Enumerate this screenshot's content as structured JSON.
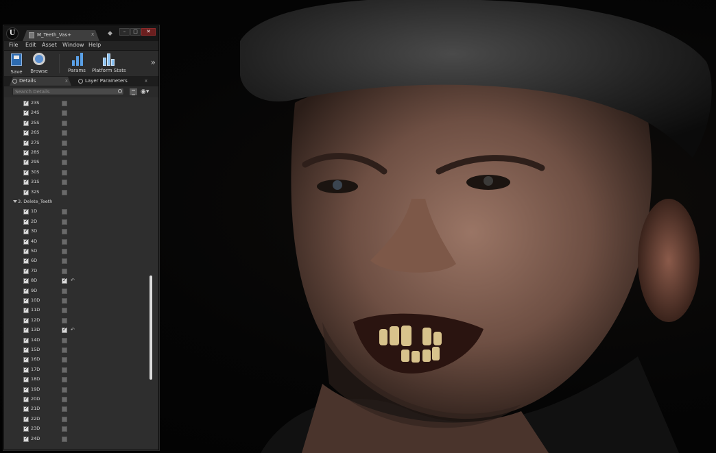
{
  "window": {
    "tab_title": "M_Teeth_Vas+",
    "tab_close": "x"
  },
  "menu": [
    "File",
    "Edit",
    "Asset",
    "Window",
    "Help"
  ],
  "toolbar": {
    "save_label": "Save",
    "browse_label": "Browse",
    "params_label": "Params",
    "stats_label": "Platform Stats"
  },
  "panel_tabs": {
    "details": "Details",
    "layer_parameters": "Layer Parameters"
  },
  "search": {
    "placeholder": "Search Details"
  },
  "rows_top": [
    {
      "label": "23S",
      "enabled": false
    },
    {
      "label": "24S",
      "enabled": false
    },
    {
      "label": "25S",
      "enabled": false
    },
    {
      "label": "26S",
      "enabled": false
    },
    {
      "label": "27S",
      "enabled": false
    },
    {
      "label": "28S",
      "enabled": false
    },
    {
      "label": "29S",
      "enabled": false
    },
    {
      "label": "30S",
      "enabled": false
    },
    {
      "label": "31S",
      "enabled": false
    },
    {
      "label": "32S",
      "enabled": false
    }
  ],
  "category": {
    "label": "3. Delete_Teeth"
  },
  "rows_delete": [
    {
      "label": "1D",
      "enabled": false
    },
    {
      "label": "2D",
      "enabled": false
    },
    {
      "label": "3D",
      "enabled": false
    },
    {
      "label": "4D",
      "enabled": false
    },
    {
      "label": "5D",
      "enabled": false
    },
    {
      "label": "6D",
      "enabled": false
    },
    {
      "label": "7D",
      "enabled": false
    },
    {
      "label": "8D",
      "enabled": true
    },
    {
      "label": "9D",
      "enabled": false
    },
    {
      "label": "10D",
      "enabled": false
    },
    {
      "label": "11D",
      "enabled": false
    },
    {
      "label": "12D",
      "enabled": false
    },
    {
      "label": "13D",
      "enabled": true
    },
    {
      "label": "14D",
      "enabled": false
    },
    {
      "label": "15D",
      "enabled": false
    },
    {
      "label": "16D",
      "enabled": false
    },
    {
      "label": "17D",
      "enabled": false
    },
    {
      "label": "18D",
      "enabled": false
    },
    {
      "label": "19D",
      "enabled": false
    },
    {
      "label": "20D",
      "enabled": false
    },
    {
      "label": "21D",
      "enabled": false
    },
    {
      "label": "22D",
      "enabled": false
    },
    {
      "label": "23D",
      "enabled": false
    },
    {
      "label": "24D",
      "enabled": false
    }
  ],
  "icons": {
    "reset": "reset-to-default-icon",
    "eye": "visibility-eye-icon",
    "overflow": "toolbar-overflow-chevron-icon"
  }
}
